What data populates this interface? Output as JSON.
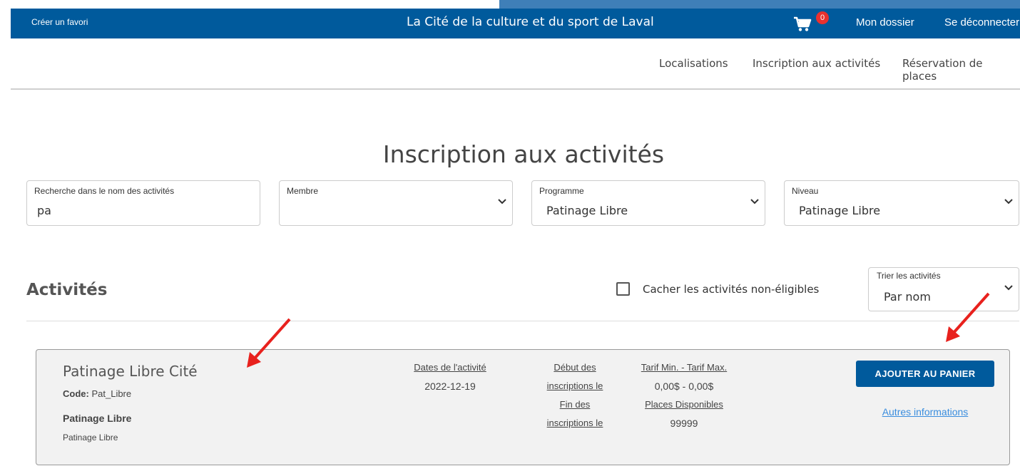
{
  "topbar": {
    "favorite_label": "Créer un favori",
    "site_title": "La Cité de la culture et du sport de Laval",
    "cart_icon": "cart-icon",
    "cart_count": "0",
    "my_file_label": "Mon dossier",
    "logout_label": "Se déconnecter"
  },
  "nav": {
    "items": [
      {
        "label": "Localisations"
      },
      {
        "label": "Inscription aux activités"
      },
      {
        "label": "Réservation de places"
      }
    ]
  },
  "page_title": "Inscription aux activités",
  "filters": {
    "search": {
      "label": "Recherche dans le nom des activités",
      "value": "pa"
    },
    "member": {
      "label": "Membre",
      "value": ""
    },
    "program": {
      "label": "Programme",
      "value": "Patinage Libre"
    },
    "level": {
      "label": "Niveau",
      "value": "Patinage Libre"
    }
  },
  "activities": {
    "title": "Activités",
    "hide_ineligible_label": "Cacher les activités non-éligibles",
    "hide_ineligible_checked": false,
    "sort": {
      "label": "Trier les activités",
      "value": "Par nom"
    }
  },
  "activity": {
    "name": "Patinage Libre Cité",
    "code_label": "Code:",
    "code_value": "Pat_Libre",
    "program": "Patinage Libre",
    "level": "Patinage Libre",
    "dates_label": "Dates de l'activité",
    "dates_value": "2022-12-19",
    "reg_start_label_1": "Début des",
    "reg_start_label_2": "inscriptions le",
    "reg_end_label_1": "Fin des",
    "reg_end_label_2": "inscriptions le",
    "price_label": "Tarif Min. - Tarif Max.",
    "price_value": "0,00$ - 0,00$",
    "places_label": "Places Disponibles",
    "places_value": "99999",
    "add_button": "AJOUTER AU PANIER",
    "more_info": "Autres informations"
  },
  "colors": {
    "topbar": "#005a9c",
    "badge": "#e8312f",
    "link": "#3a8dde",
    "annotation_arrow": "#e8211d"
  }
}
